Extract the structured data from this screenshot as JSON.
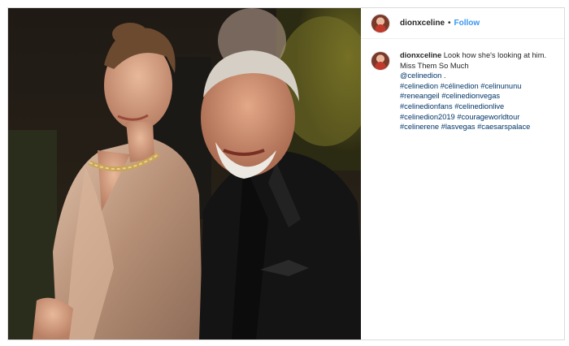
{
  "post": {
    "username": "dionxceline",
    "separator": "•",
    "follow_label": "Follow",
    "caption": {
      "username": "dionxceline",
      "text": "Look how she's looking at him. Miss Them So Much",
      "mention": "@celinedion",
      "mention_suffix": ".",
      "hashtags": [
        "#celinedion",
        "#célinedion",
        "#celinununu",
        "#reneangeil",
        "#celinedionvegas",
        "#celinedionfans",
        "#celinedionlive",
        "#celinedion2019",
        "#courageworldtour",
        "#celinerene",
        "#lasvegas",
        "#caesarspalace"
      ]
    }
  },
  "colors": {
    "link": "#3897f0",
    "hashtag": "#003569",
    "border": "#dbdbdb"
  }
}
